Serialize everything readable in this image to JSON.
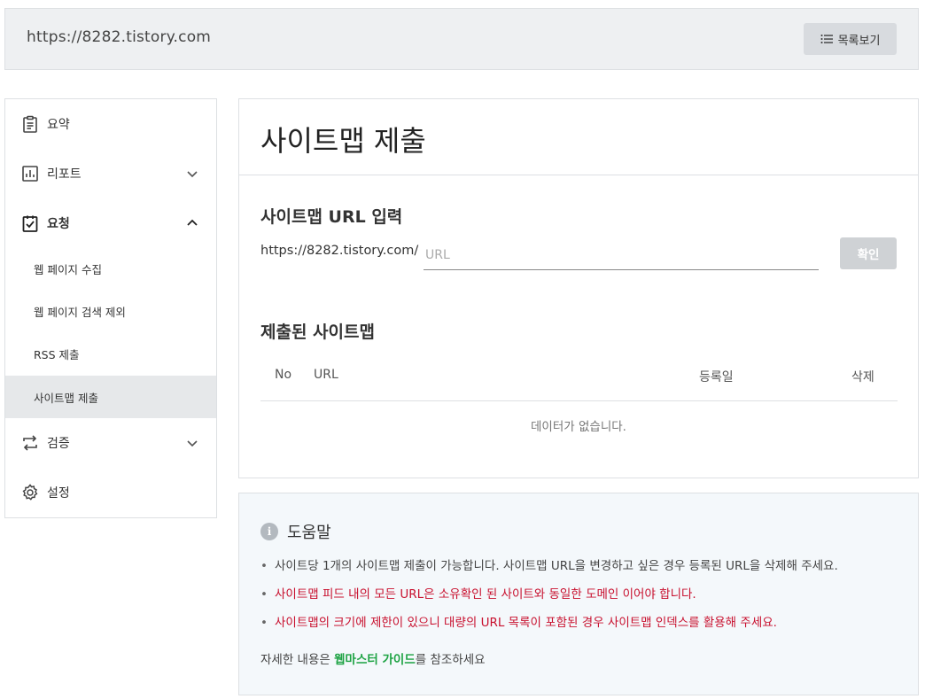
{
  "header": {
    "site_url": "https://8282.tistory.com",
    "list_button": "목록보기"
  },
  "sidebar": {
    "items": [
      {
        "label": "요약",
        "icon": "clipboard-icon"
      },
      {
        "label": "리포트",
        "icon": "bar-chart-icon",
        "chevron": "down"
      },
      {
        "label": "요청",
        "icon": "clipboard-check-icon",
        "chevron": "up"
      },
      {
        "label": "웹 페이지 수집"
      },
      {
        "label": "웹 페이지 검색 제외"
      },
      {
        "label": "RSS 제출"
      },
      {
        "label": "사이트맵 제출",
        "active": true
      },
      {
        "label": "검증",
        "icon": "swap-arrows-icon",
        "chevron": "down"
      },
      {
        "label": "설정",
        "icon": "gear-icon"
      }
    ]
  },
  "main": {
    "title": "사이트맵 제출",
    "url_section_title": "사이트맵 URL 입력",
    "url_prefix": "https://8282.tistory.com/",
    "url_placeholder": "URL",
    "confirm_button": "확인",
    "submitted_title": "제출된 사이트맵",
    "table": {
      "headers": [
        "No",
        "URL",
        "등록일",
        "삭제"
      ],
      "empty_message": "데이터가 없습니다."
    }
  },
  "help": {
    "title": "도움말",
    "bullets": [
      "사이트당 1개의 사이트맵 제출이 가능합니다. 사이트맵 URL을 변경하고 싶은 경우 등록된 URL을 삭제해 주세요.",
      "사이트맵 피드 내의 모든 URL은 소유확인 된 사이트와 동일한 도메인 이어야 합니다.",
      "사이트맵의 크기에 제한이 있으니 대량의 URL 목록이 포함된 경우 사이트맵 인덱스를 활용해 주세요."
    ],
    "footer_prefix": "자세한 내용은 ",
    "footer_link": "웹마스터 가이드",
    "footer_suffix": "를 참조하세요"
  },
  "colors": {
    "warning_red": "#c8102e",
    "link_green": "#1ea344",
    "active_bg": "#e6e8ea"
  }
}
